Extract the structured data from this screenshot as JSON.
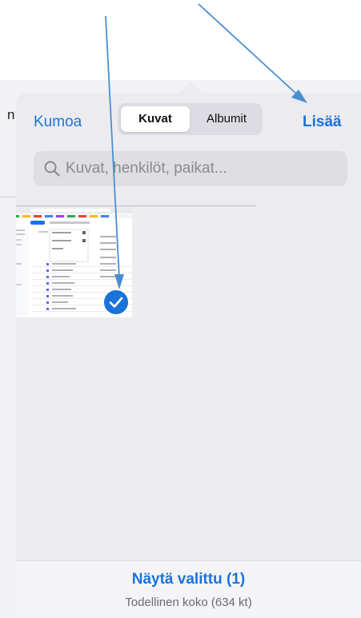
{
  "background": {
    "edge_text": "n"
  },
  "header": {
    "cancel_label": "Kumoa",
    "tabs": [
      {
        "label": "Kuvat",
        "selected": true
      },
      {
        "label": "Albumit",
        "selected": false
      }
    ],
    "add_label": "Lisää"
  },
  "search": {
    "placeholder": "Kuvat, henkilöt, paikat..."
  },
  "grid": {
    "items": [
      {
        "selected": true
      }
    ],
    "selected_count": 1
  },
  "footer": {
    "show_selected_label": "Näytä valittu (1)",
    "size_label": "Todellinen koko (634 kt)"
  },
  "colors": {
    "accent": "#1a73d9",
    "annotation_arrow": "#4a8ed0"
  }
}
